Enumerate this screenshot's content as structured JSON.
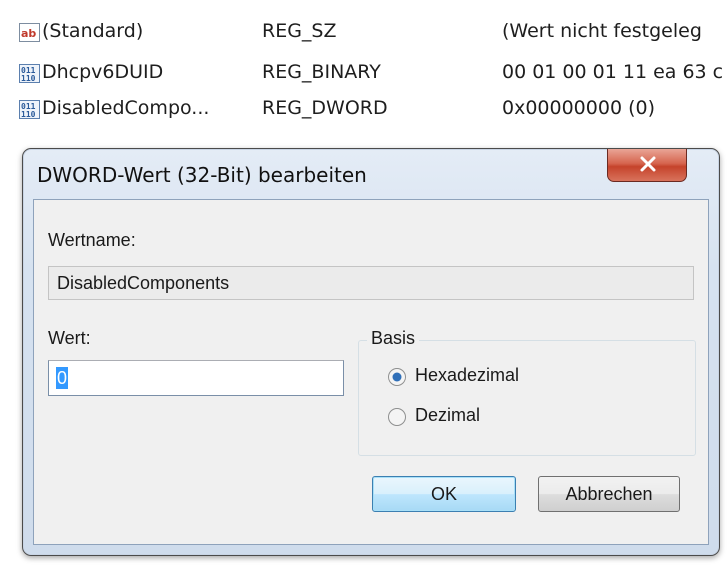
{
  "registry": {
    "rows": [
      {
        "icon": "string-value-icon",
        "name": "(Standard)",
        "type": "REG_SZ",
        "data": "(Wert nicht festgeleg"
      },
      {
        "icon": "binary-value-icon",
        "name": "Dhcpv6DUID",
        "type": "REG_BINARY",
        "data": "00 01 00 01 11 ea 63 c"
      },
      {
        "icon": "binary-value-icon",
        "name": "DisabledCompo...",
        "type": "REG_DWORD",
        "data": "0x00000000 (0)"
      }
    ]
  },
  "dialog": {
    "title": "DWORD-Wert (32-Bit) bearbeiten",
    "close_icon": "close-icon",
    "valuename_label": "Wertname:",
    "valuename": "DisabledComponents",
    "value_label": "Wert:",
    "value": "0",
    "basis_label": "Basis",
    "basis_options": [
      {
        "label": "Hexadezimal",
        "selected": true
      },
      {
        "label": "Dezimal",
        "selected": false
      }
    ],
    "ok_label": "OK",
    "cancel_label": "Abbrechen"
  },
  "colors": {
    "close_button": "#c5432b",
    "ok_button_border": "#3c7fb1",
    "selection": "#3399ff"
  }
}
